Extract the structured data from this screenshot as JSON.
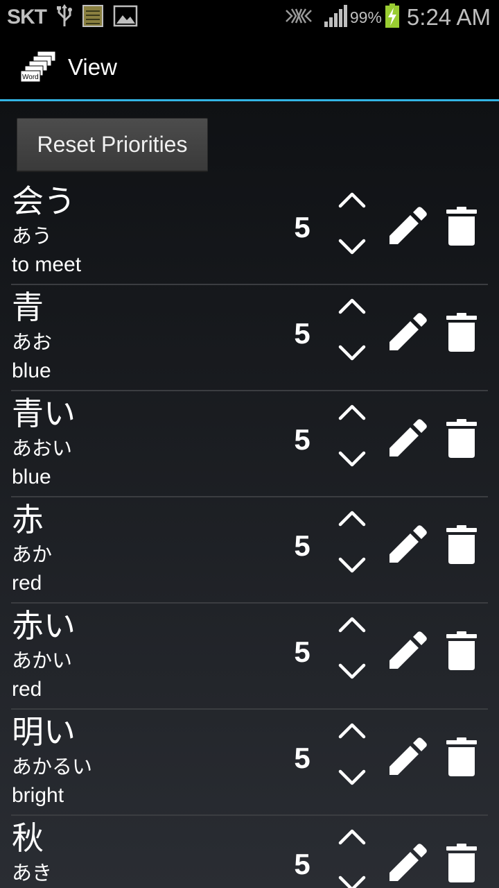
{
  "status_bar": {
    "carrier": "SKT",
    "battery_percent": "99%",
    "time": "5:24 AM"
  },
  "action_bar": {
    "title": "View",
    "logo_text": "Word"
  },
  "reset_button_label": "Reset Priorities",
  "words": [
    {
      "kanji": "会う",
      "kana": "あう",
      "meaning": "to meet",
      "priority": "5"
    },
    {
      "kanji": "青",
      "kana": "あお",
      "meaning": "blue",
      "priority": "5"
    },
    {
      "kanji": "青い",
      "kana": "あおい",
      "meaning": "blue",
      "priority": "5"
    },
    {
      "kanji": "赤",
      "kana": "あか",
      "meaning": "red",
      "priority": "5"
    },
    {
      "kanji": "赤い",
      "kana": "あかい",
      "meaning": "red",
      "priority": "5"
    },
    {
      "kanji": "明い",
      "kana": "あかるい",
      "meaning": "bright",
      "priority": "5"
    },
    {
      "kanji": "秋",
      "kana": "あき",
      "meaning": "",
      "priority": "5"
    }
  ],
  "colors": {
    "accent": "#33b5e5",
    "divider": "#3b3d41",
    "status_text": "#bfbfbf"
  }
}
